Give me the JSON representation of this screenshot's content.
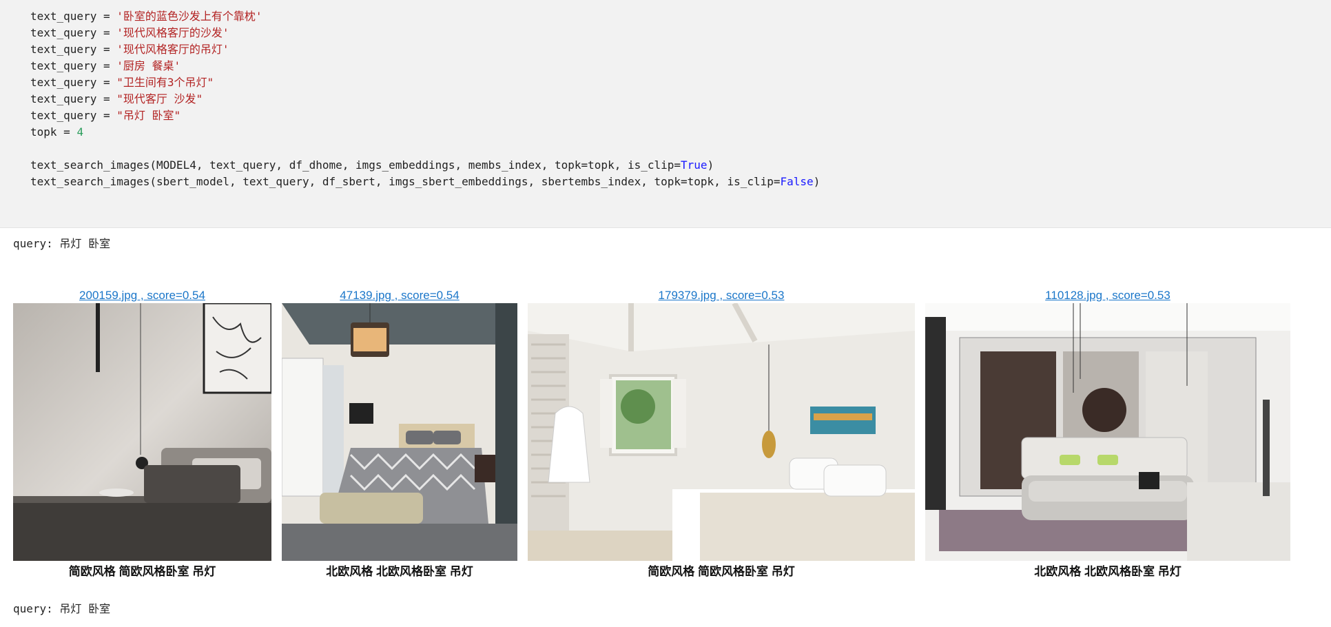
{
  "code": {
    "lines": [
      {
        "var": "text_query",
        "op": " = ",
        "quote": "'",
        "value": "卧室的蓝色沙发上有个靠枕"
      },
      {
        "var": "text_query",
        "op": " = ",
        "quote": "'",
        "value": "现代风格客厅的沙发"
      },
      {
        "var": "text_query",
        "op": " = ",
        "quote": "'",
        "value": "现代风格客厅的吊灯"
      },
      {
        "var": "text_query",
        "op": " = ",
        "quote": "'",
        "value": "厨房 餐桌"
      },
      {
        "var": "text_query",
        "op": " = ",
        "quote": "\"",
        "value": "卫生间有3个吊灯"
      },
      {
        "var": "text_query",
        "op": " = ",
        "quote": "\"",
        "value": "现代客厅 沙发"
      },
      {
        "var": "text_query",
        "op": " = ",
        "quote": "\"",
        "value": "吊灯 卧室"
      }
    ],
    "topk_var": "topk",
    "topk_op": " = ",
    "topk_value": "4",
    "call1_fn": "text_search_images(",
    "call1_args": "MODEL4, text_query, df_dhome, imgs_embeddings, membs_index, topk=topk, is_clip=",
    "call1_bool": "True",
    "call1_end": ")",
    "call2_fn": "text_search_images(",
    "call2_args": "sbert_model, text_query, df_sbert, imgs_sbert_embeddings, sbertembs_index, topk=topk, is_clip=",
    "call2_bool": "False",
    "call2_end": ")"
  },
  "output": {
    "query_line_1": "query: 吊灯 卧室",
    "query_line_2": "query: 吊灯 卧室",
    "results": [
      {
        "link": "200159.jpg , score=0.54",
        "caption": "简欧风格 简欧风格卧室 吊灯"
      },
      {
        "link": "47139.jpg , score=0.54",
        "caption": "北欧风格 北欧风格卧室 吊灯"
      },
      {
        "link": "179379.jpg , score=0.53",
        "caption": "简欧风格 简欧风格卧室 吊灯"
      },
      {
        "link": "110128.jpg , score=0.53",
        "caption": "北欧风格 北欧风格卧室 吊灯"
      }
    ]
  },
  "colors": {
    "cell_bg": "#f2f2f2",
    "string": "#b22222",
    "number": "#2a9d5b",
    "keyword": "#1a1aff",
    "link": "#1a76c9"
  }
}
